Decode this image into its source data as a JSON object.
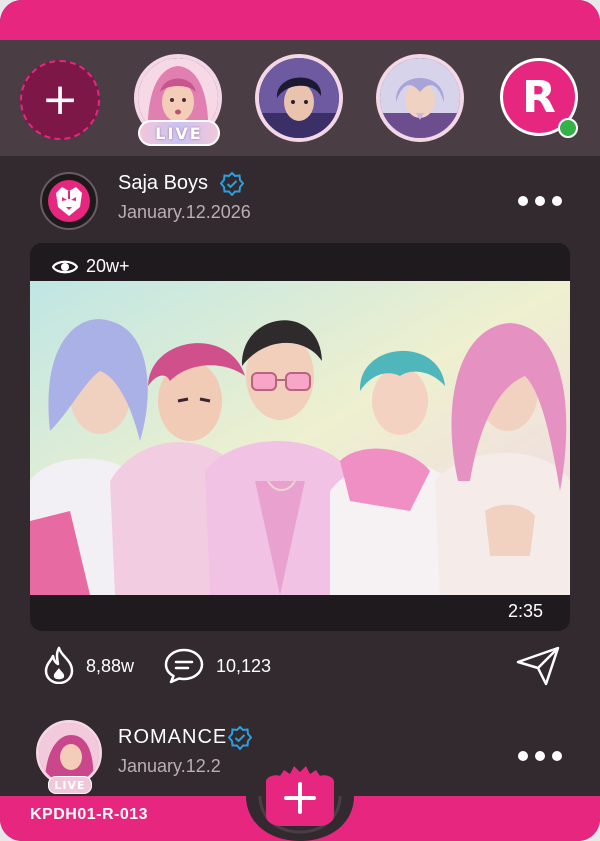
{
  "stories": {
    "add_icon": "plus-icon",
    "items": [
      {
        "name": "story-pink-hair",
        "live": true,
        "colors": [
          "#e8a2c5",
          "#c25a8f"
        ]
      },
      {
        "name": "story-dark-hair",
        "live": false,
        "colors": [
          "#6b5fa8",
          "#2c2748"
        ]
      },
      {
        "name": "story-lavender-hair",
        "live": false,
        "colors": [
          "#b6b2d9",
          "#8f7fb8"
        ]
      }
    ],
    "live_label": "LIVE",
    "brand_logo": "R",
    "online": true
  },
  "post": {
    "author": "Saja Boys",
    "date": "January.12.2026",
    "views": "20w+",
    "duration": "2:35",
    "likes": "8,88w",
    "comments": "10,123"
  },
  "next_post": {
    "author": "ROMANCE",
    "date": "January.12.2",
    "live_label": "LIVE"
  },
  "card_code": "KPDH01-R-013",
  "colors": {
    "accent": "#e6267f",
    "verified": "#2c9fe0",
    "background": "#322a2e"
  }
}
